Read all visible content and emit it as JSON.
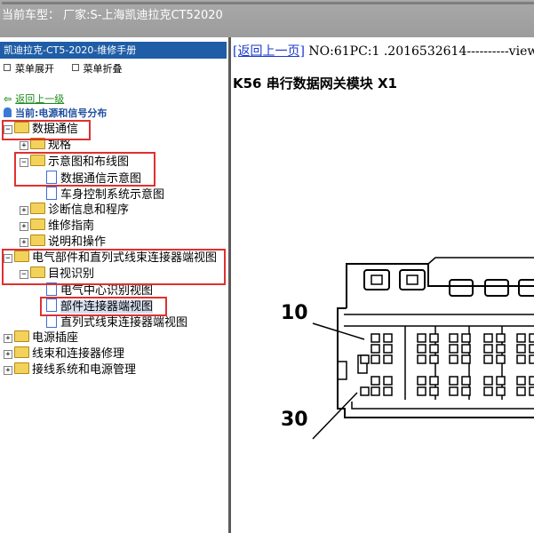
{
  "window": {
    "title": "当前车型： 厂家:S-上海凯迪拉克CT52020"
  },
  "sidebar": {
    "header": "凯迪拉克-CT5-2020-维修手册",
    "expand_label": "菜单展开",
    "collapse_label": "菜单折叠",
    "back_link": "返回上一级",
    "current": "当前:电源和信号分布",
    "tree": [
      {
        "label": "数据通信"
      },
      {
        "label": "规格"
      },
      {
        "label": "示意图和布线图"
      },
      {
        "label": "数据通信示意图"
      },
      {
        "label": "车身控制系统示意图"
      },
      {
        "label": "诊断信息和程序"
      },
      {
        "label": "维修指南"
      },
      {
        "label": "说明和操作"
      },
      {
        "label": "电气部件和直列式线束连接器端视图"
      },
      {
        "label": "目视识别"
      },
      {
        "label": "电气中心识别视图"
      },
      {
        "label": "部件连接器端视图"
      },
      {
        "label": "直列式线束连接器端视图"
      },
      {
        "label": "电源插座"
      },
      {
        "label": "线束和连接器修理"
      },
      {
        "label": "接线系统和电源管理"
      }
    ]
  },
  "content": {
    "back_link": "[返回上一页]",
    "doc_info": " NO:61PC:1 .2016532614----------view",
    "heading": "K56 串行数据网关模块 X1",
    "callout_top": "10",
    "callout_bottom": "30"
  },
  "colors": {
    "accent_header": "#1f5da6",
    "highlight": "#e03030",
    "link": "#1a3acc",
    "back_green": "#1a8a1a"
  }
}
